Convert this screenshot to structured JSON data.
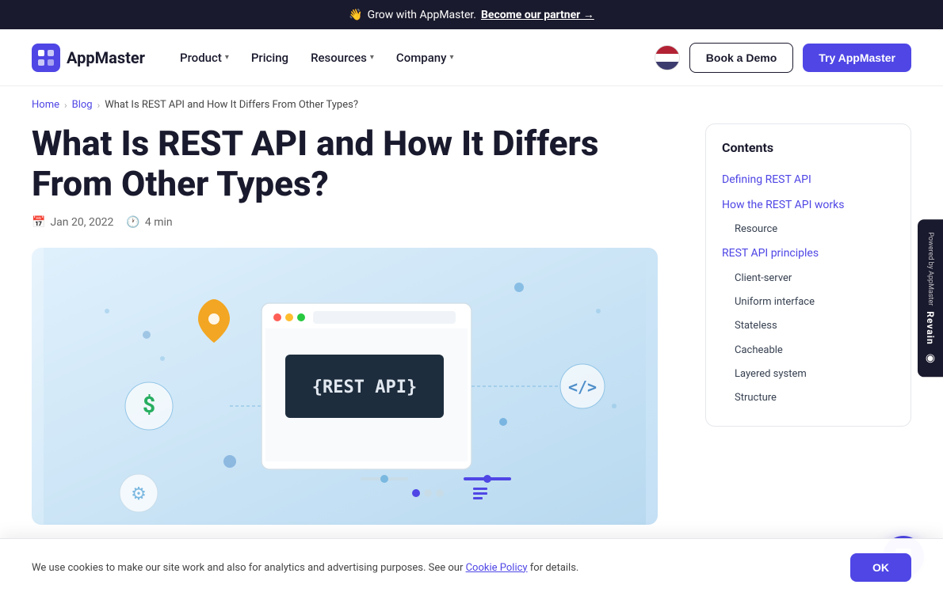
{
  "banner": {
    "emoji": "👋",
    "text": "Grow with AppMaster.",
    "cta": "Become our partner →"
  },
  "header": {
    "logo": {
      "icon": "◈",
      "text": "AppMaster"
    },
    "nav": [
      {
        "label": "Product",
        "hasDropdown": true
      },
      {
        "label": "Pricing",
        "hasDropdown": false
      },
      {
        "label": "Resources",
        "hasDropdown": true
      },
      {
        "label": "Company",
        "hasDropdown": true
      }
    ],
    "buttons": {
      "demo": "Book a Demo",
      "try": "Try AppMaster"
    }
  },
  "breadcrumb": {
    "home": "Home",
    "blog": "Blog",
    "current": "What Is REST API and How It Differs From Other Types?"
  },
  "article": {
    "title": "What Is REST API and How It Differs From Other Types?",
    "date": "Jan 20, 2022",
    "read_time": "4 min"
  },
  "toc": {
    "title": "Contents",
    "items": [
      {
        "label": "Defining REST API",
        "indent": false
      },
      {
        "label": "How the REST API works",
        "indent": false
      },
      {
        "label": "Resource",
        "indent": true
      },
      {
        "label": "REST API principles",
        "indent": false
      },
      {
        "label": "Client-server",
        "indent": true
      },
      {
        "label": "Uniform interface",
        "indent": true
      },
      {
        "label": "Stateless",
        "indent": true
      },
      {
        "label": "Cacheable",
        "indent": true
      },
      {
        "label": "Layered system",
        "indent": true
      },
      {
        "label": "Structure",
        "indent": true
      }
    ]
  },
  "revain": {
    "label": "Powered by AppMaster",
    "brand": "Revain"
  },
  "cookie": {
    "text": "We use cookies to make our site work and also for analytics and advertising purposes. See our Cookie Policy for details.",
    "link_text": "Cookie Policy",
    "ok_label": "OK"
  }
}
